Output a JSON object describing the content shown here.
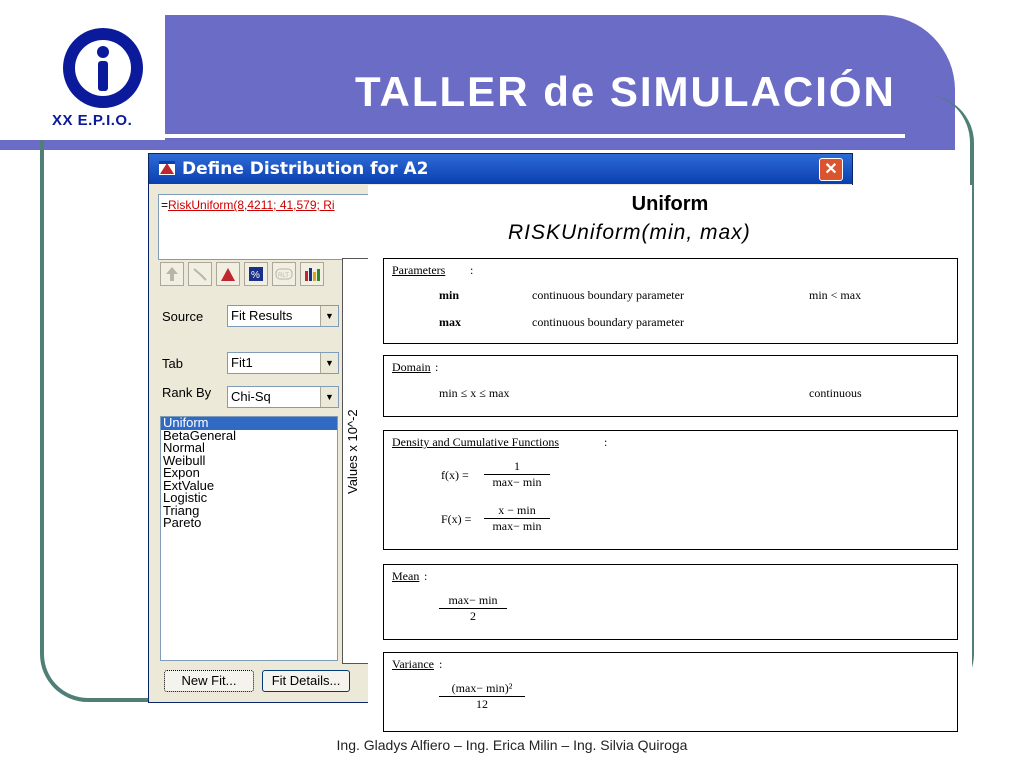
{
  "slide": {
    "title": "TALLER de SIMULACIÓN",
    "logo_text": "XX E.P.I.O.",
    "footer": "Ing. Gladys Alfiero – Ing. Erica Milin – Ing. Silvia Quiroga"
  },
  "dialog": {
    "title": "Define Distribution for A2",
    "formula_prefix": "=",
    "formula": "RiskUniform(8,4211; 41,579; Ri",
    "source_label": "Source",
    "source_value": "Fit Results",
    "tab_label": "Tab",
    "tab_value": "Fit1",
    "rank_label": "Rank By",
    "rank_value": "Chi-Sq",
    "distributions": [
      "Uniform",
      "BetaGeneral",
      "Normal",
      "Weibull",
      "Expon",
      "ExtValue",
      "Logistic",
      "Triang",
      "Pareto"
    ],
    "selected_distribution": "Uniform",
    "y_axis_label": "Values x 10^-2",
    "new_fit_button": "New Fit...",
    "fit_details_button": "Fit Details..."
  },
  "help": {
    "title": "Uniform",
    "function": "RISKUniform(min, max)",
    "parameters": {
      "heading": "Parameters",
      "rows": [
        {
          "name": "min",
          "desc": "continuous boundary parameter",
          "constraint": "min < max"
        },
        {
          "name": "max",
          "desc": "continuous boundary parameter",
          "constraint": ""
        }
      ]
    },
    "domain": {
      "heading": "Domain",
      "expr": "min ≤ x ≤ max",
      "type": "continuous"
    },
    "density": {
      "heading": "Density and Cumulative Functions",
      "f_lhs": "f(x) =",
      "f_num": "1",
      "f_den": "max− min",
      "F_lhs": "F(x) =",
      "F_num": "x − min",
      "F_den": "max− min"
    },
    "mean": {
      "heading": "Mean",
      "num": "max− min",
      "den": "2"
    },
    "variance": {
      "heading": "Variance",
      "num": "(max− min)²",
      "den": "12"
    }
  }
}
